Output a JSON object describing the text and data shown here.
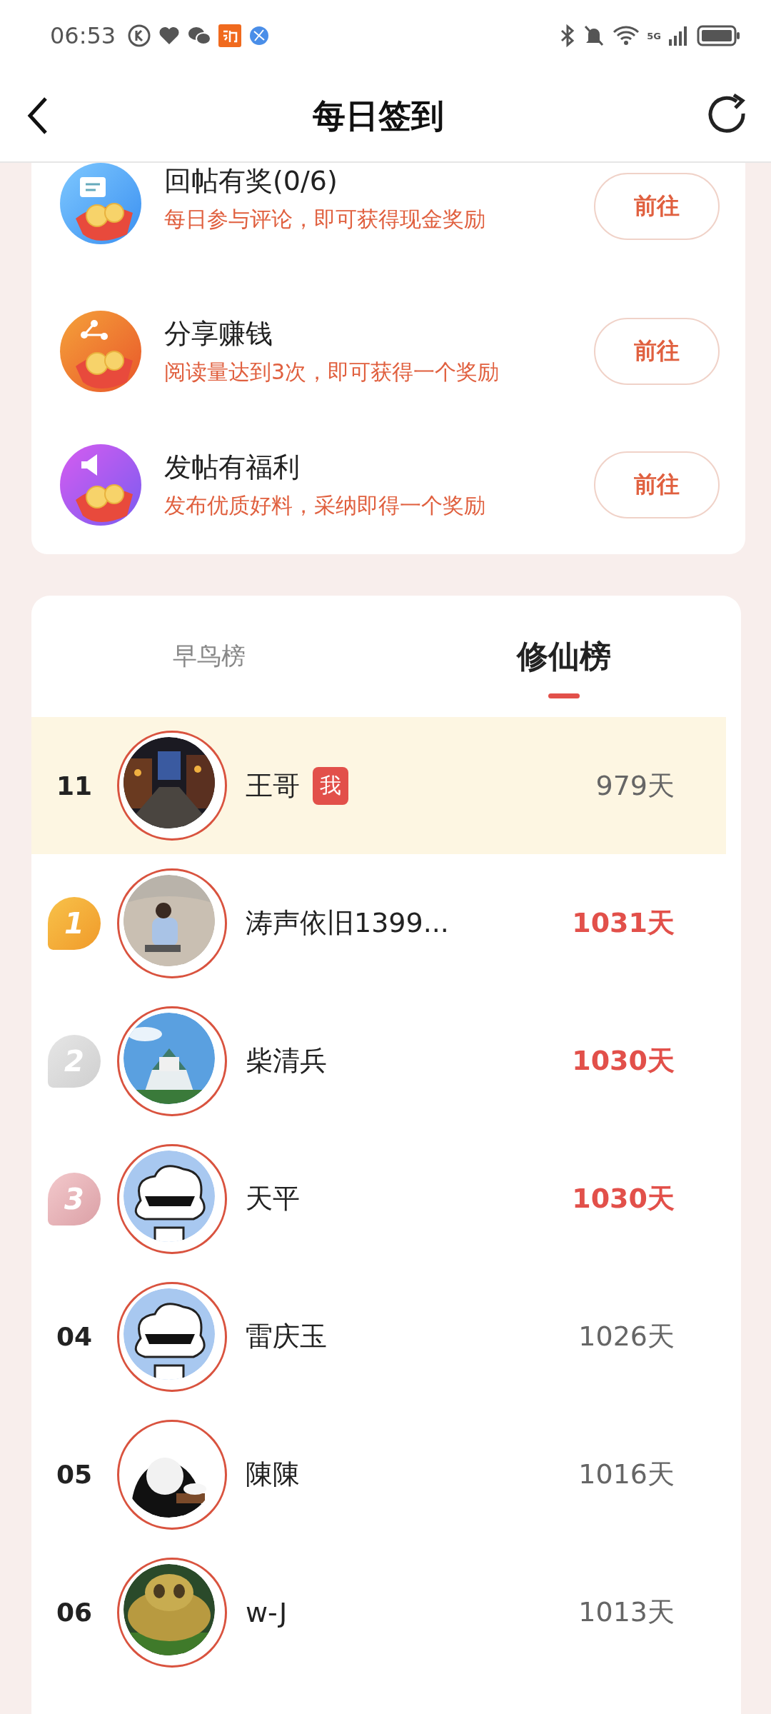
{
  "status_bar": {
    "time": "06:53",
    "network": "5G"
  },
  "header": {
    "title": "每日签到"
  },
  "tasks": [
    {
      "title": "回帖有奖(0/6)",
      "subtitle": "每日参与评论，即可获得现金奖励",
      "button": "前往",
      "kind": "comment"
    },
    {
      "title": "分享赚钱",
      "subtitle": "阅读量达到3次，即可获得一个奖励",
      "button": "前往",
      "kind": "share"
    },
    {
      "title": "发帖有福利",
      "subtitle": "发布优质好料，采纳即得一个奖励",
      "button": "前往",
      "kind": "post"
    }
  ],
  "tabs": [
    {
      "label": "早鸟榜",
      "selected": false
    },
    {
      "label": "修仙榜",
      "selected": true
    }
  ],
  "ranking": [
    {
      "rank": "11",
      "kind": "plain",
      "name": "王哥",
      "tag": "我",
      "days": "979天",
      "top": false
    },
    {
      "rank": "1",
      "kind": "gold",
      "name": "涛声依旧1399...",
      "days": "1031天",
      "top": true
    },
    {
      "rank": "2",
      "kind": "silver",
      "name": "柴清兵",
      "days": "1030天",
      "top": true
    },
    {
      "rank": "3",
      "kind": "bronze",
      "name": "天平",
      "days": "1030天",
      "top": true
    },
    {
      "rank": "04",
      "kind": "plain",
      "name": "雷庆玉",
      "days": "1026天",
      "top": false
    },
    {
      "rank": "05",
      "kind": "plain",
      "name": "陳陳",
      "days": "1016天",
      "top": false
    },
    {
      "rank": "06",
      "kind": "plain",
      "name": "w-J",
      "days": "1013天",
      "top": false
    }
  ]
}
